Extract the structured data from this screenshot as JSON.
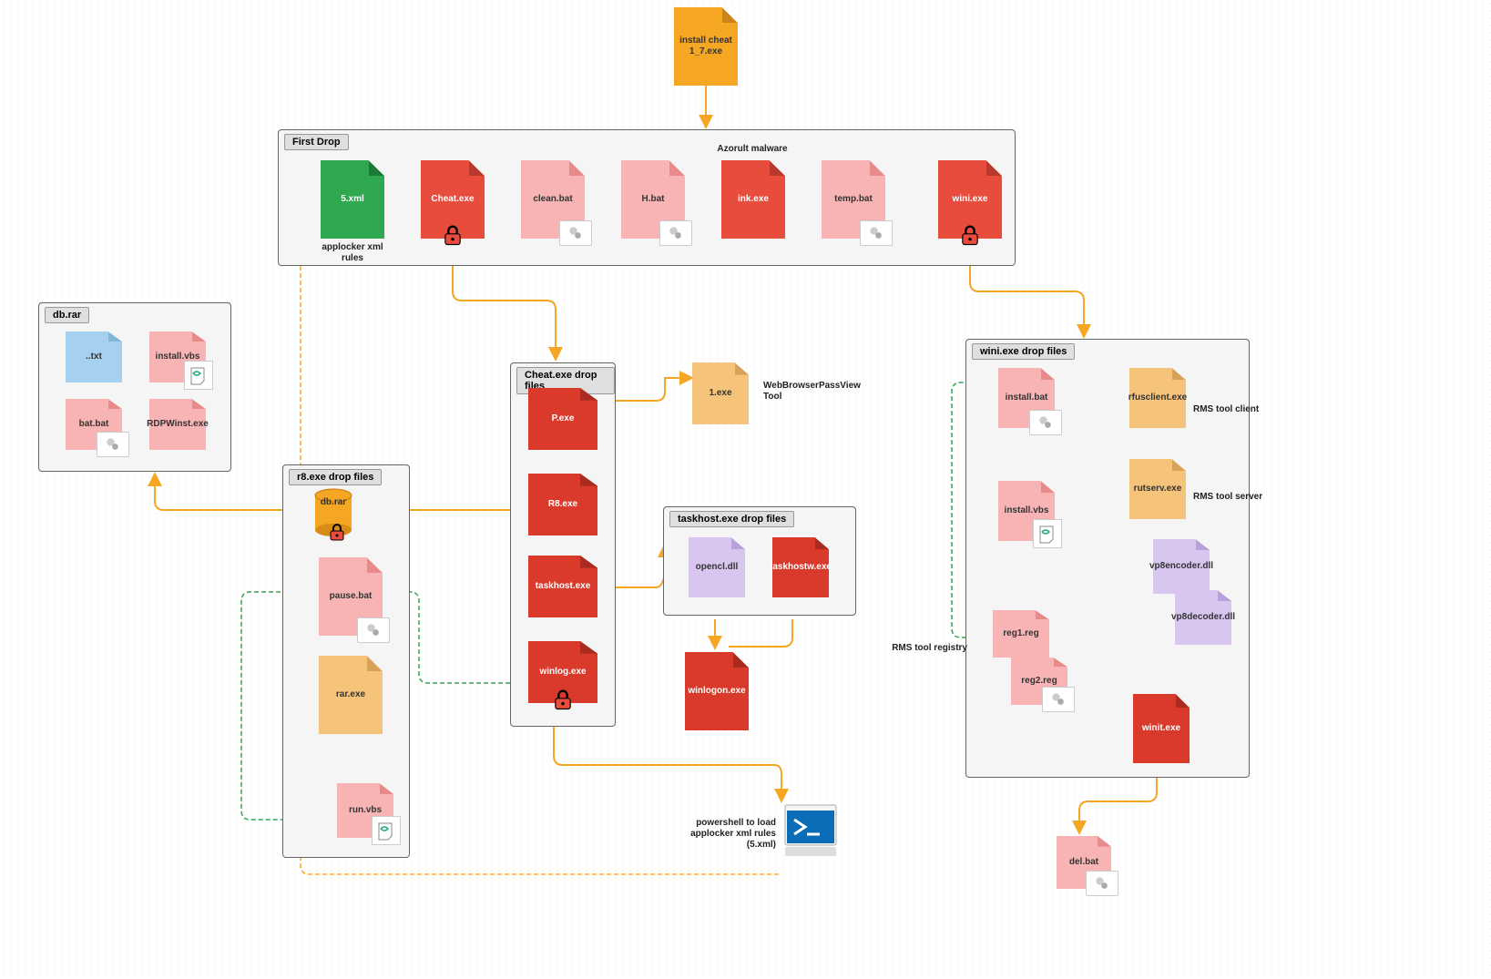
{
  "root": {
    "label": "install cheat 1_7.exe"
  },
  "containers": {
    "firstDrop": {
      "title": "First Drop"
    },
    "dbrar": {
      "title": "db.rar"
    },
    "r8": {
      "title": "r8.exe drop files"
    },
    "cheat": {
      "title": "Cheat.exe drop files"
    },
    "taskhost": {
      "title": "taskhost.exe drop files"
    },
    "wini": {
      "title": "wini.exe drop files"
    }
  },
  "firstDrop": {
    "f1": "5.xml",
    "f1_sub": "applocker xml rules",
    "f2": "Cheat.exe",
    "f3": "clean.bat",
    "f4": "H.bat",
    "f5": "ink.exe",
    "f5_top": "Azorult malware",
    "f6": "temp.bat",
    "f7": "wini.exe"
  },
  "dbrar": {
    "f1": "..txt",
    "f2": "install.vbs",
    "f3": "bat.bat",
    "f4": "RDPWinst.exe"
  },
  "r8": {
    "f1": "db.rar",
    "f2": "pause.bat",
    "f3": "rar.exe",
    "f4": "run.vbs"
  },
  "cheat": {
    "f1": "P.exe",
    "f2": "R8.exe",
    "f3": "taskhost.exe",
    "f4": "winlog.exe"
  },
  "oneexe": {
    "label": "1.exe",
    "sub": "WebBrowserPassView Tool"
  },
  "taskhost": {
    "f1": "opencl.dll",
    "f2": "taskhostw.exe"
  },
  "winlogon": {
    "label": "winlogon.exe"
  },
  "ps": {
    "label": "powershell to load applocker xml rules (5.xml)"
  },
  "wini": {
    "f1": "install.bat",
    "f2": "rfusclient.exe",
    "f2_sub": "RMS tool client",
    "f3": "install.vbs",
    "f4": "rutserv.exe",
    "f4_sub": "RMS tool server",
    "f5": "reg1.reg",
    "f5_sub": "RMS tool registry",
    "f6": "vp8encoder.dll",
    "f7": "reg2.reg",
    "f8": "vp8decoder.dll",
    "f9": "winit.exe"
  },
  "delbat": {
    "label": "del.bat"
  }
}
